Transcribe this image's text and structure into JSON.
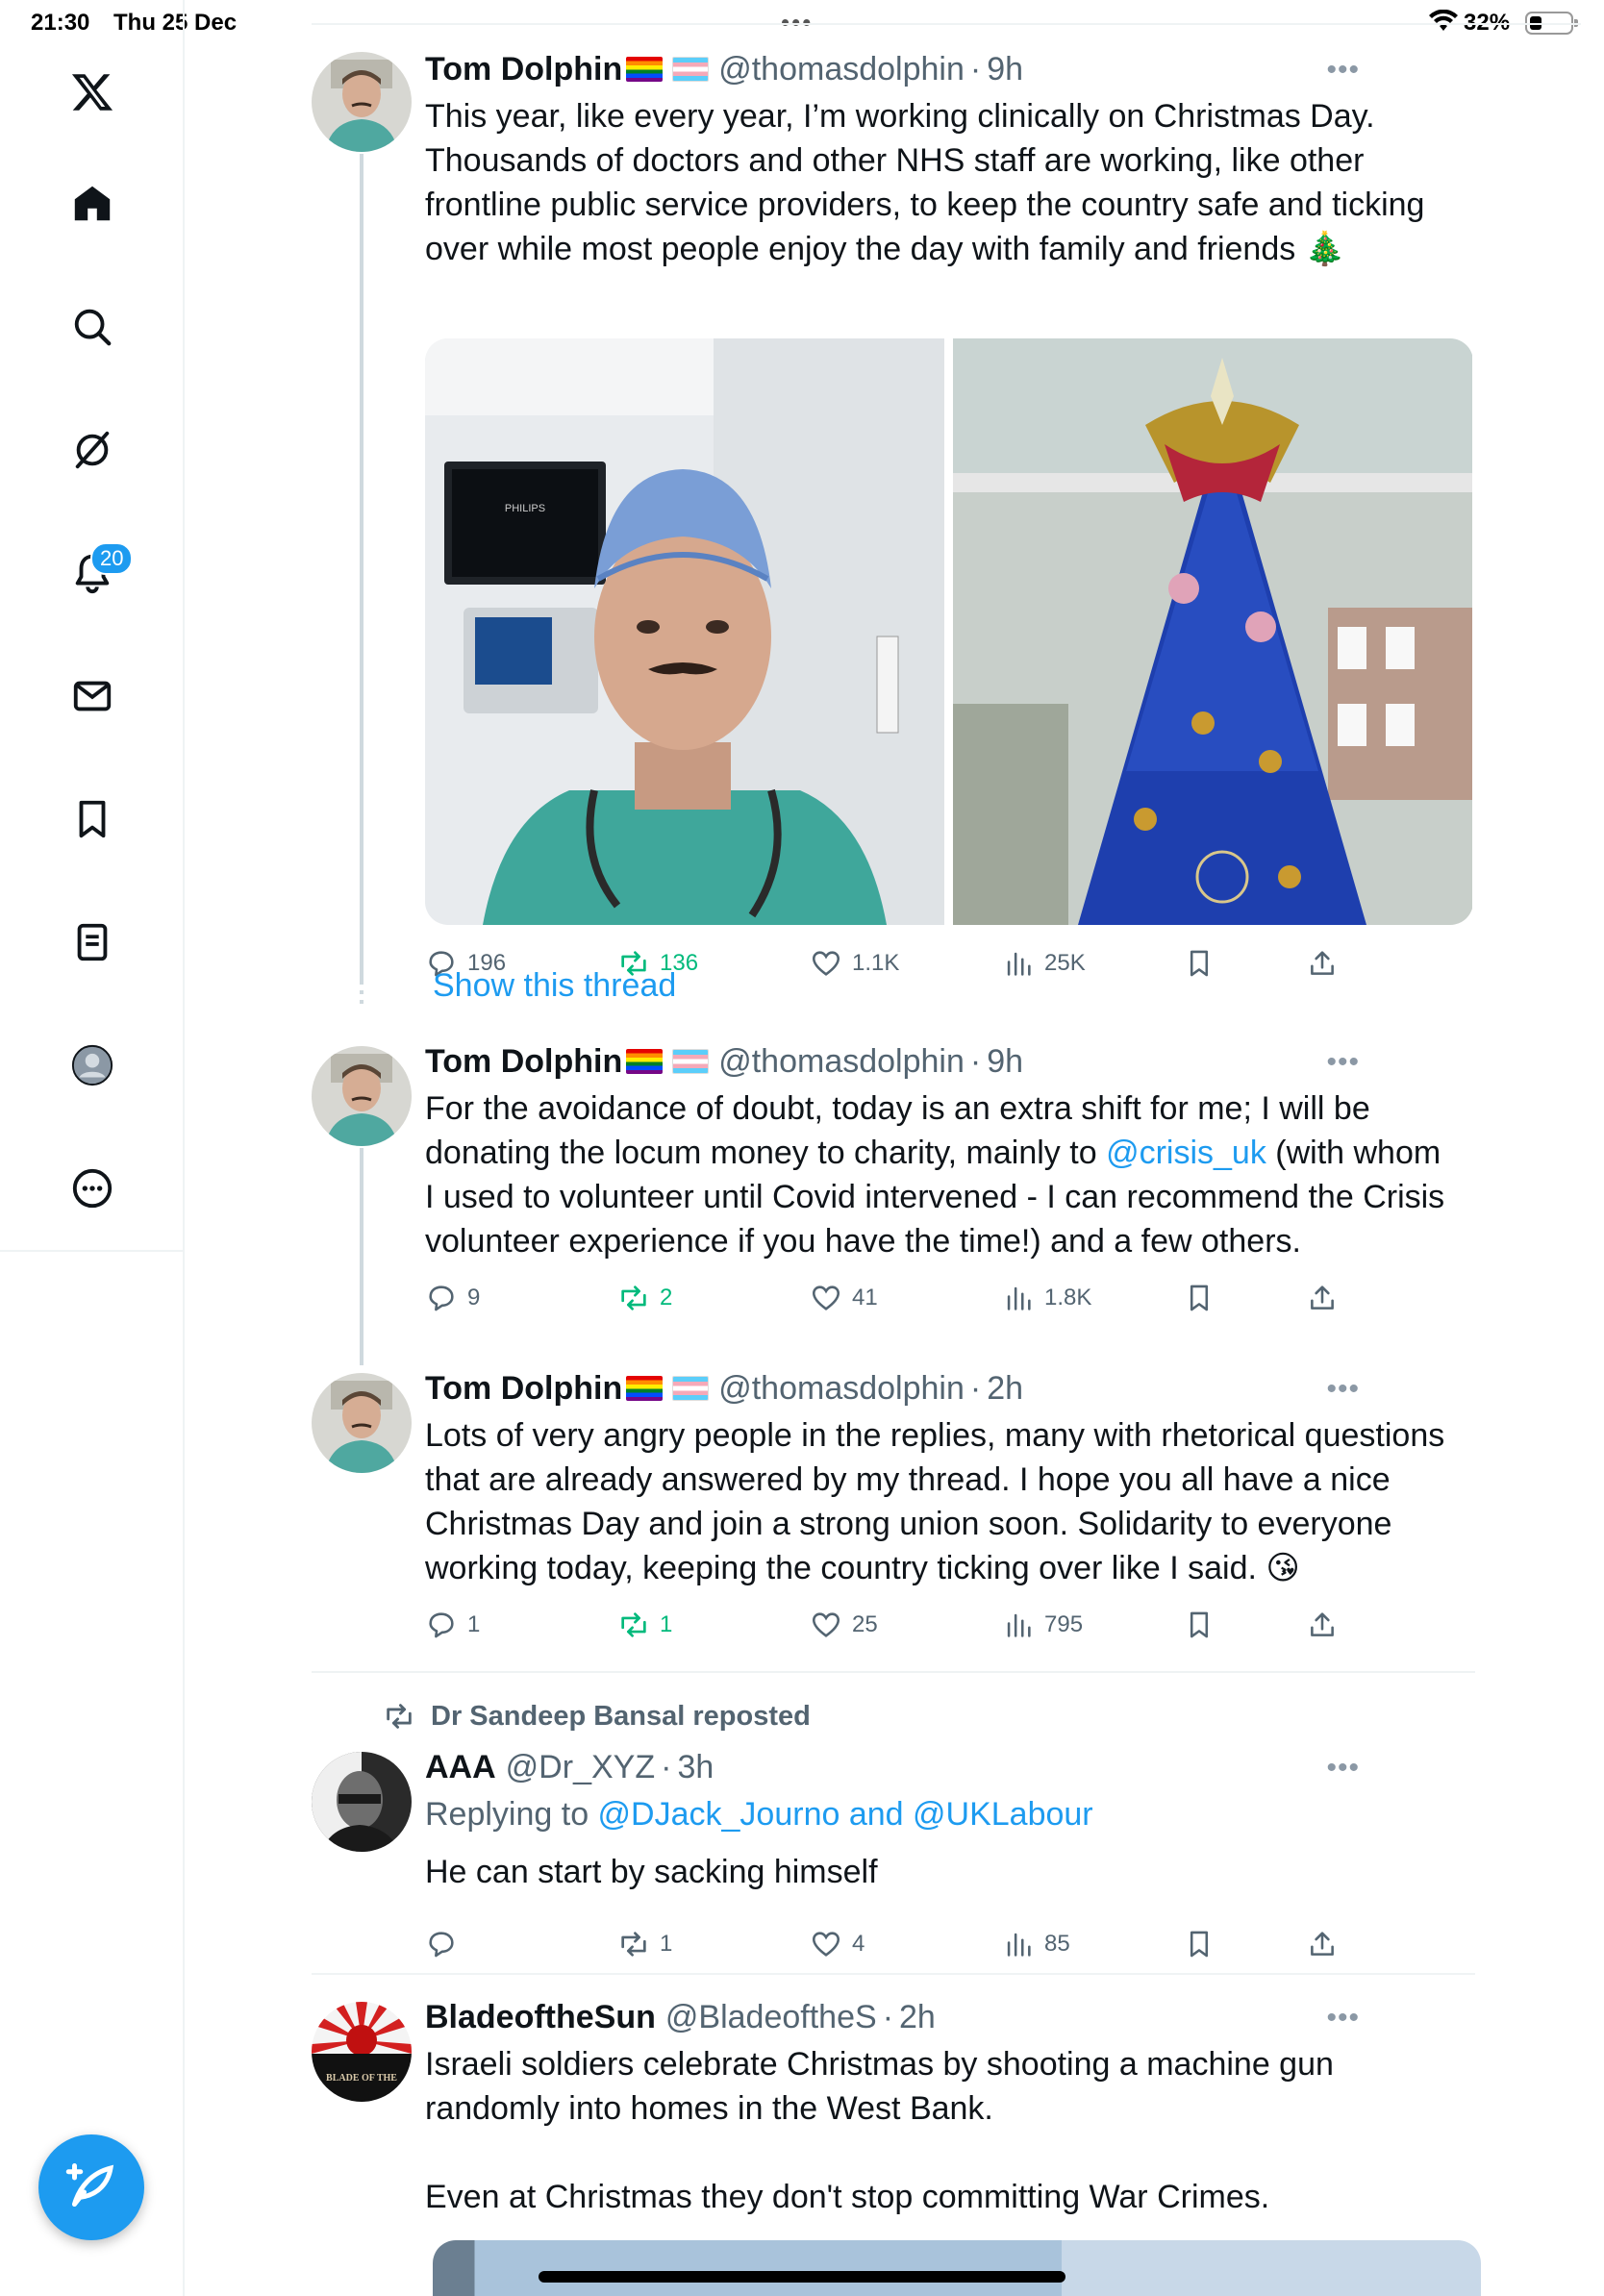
{
  "status_bar": {
    "time": "21:30",
    "date": "Thu 25 Dec",
    "battery": "32%",
    "multitask_dots": "•••"
  },
  "sidebar": {
    "items": [
      {
        "name": "x-logo-icon"
      },
      {
        "name": "home-icon"
      },
      {
        "name": "search-icon"
      },
      {
        "name": "grok-icon"
      },
      {
        "name": "notifications-icon",
        "badge": "20"
      },
      {
        "name": "messages-icon"
      },
      {
        "name": "bookmarks-icon"
      },
      {
        "name": "lists-icon"
      },
      {
        "name": "profile-icon"
      },
      {
        "name": "more-icon"
      }
    ],
    "compose_icon": "compose-feather-icon"
  },
  "tweets": [
    {
      "name": "Tom Dolphin",
      "handle": "@thomasdolphin",
      "age": "9h",
      "more": "•••",
      "lines": [
        "This year, like every year, I’m working clinically on Christmas Day.",
        "Thousands of doctors and other NHS staff are working, like other",
        "frontline public service providers, to keep the country safe and ticking",
        "over while most people enjoy the day with family and friends 🎄"
      ],
      "stats": {
        "replies": "196",
        "reposts": "136",
        "likes": "1.1K",
        "views": "25K"
      }
    },
    {
      "name": "Tom Dolphin",
      "handle": "@thomasdolphin",
      "age": "9h",
      "more": "•••",
      "line1": "For the avoidance of doubt, today is an extra shift for me; I will be",
      "line2_pre": "donating the locum money to charity, mainly to ",
      "line2_link": "@crisis_uk",
      "line2_post": " (with whom",
      "line3": "I used to volunteer until Covid intervened - I can recommend the Crisis",
      "line4": "volunteer experience if you have the time!) and a few others.",
      "stats": {
        "replies": "9",
        "reposts": "2",
        "likes": "41",
        "views": "1.8K"
      }
    },
    {
      "name": "Tom Dolphin",
      "handle": "@thomasdolphin",
      "age": "2h",
      "more": "•••",
      "lines": [
        "Lots of very angry people in the replies, many with rhetorical questions",
        "that are already answered by my thread. I hope you all have a nice",
        "Christmas Day and join a strong union soon. Solidarity to everyone",
        "working today, keeping the country ticking over like I said. 😘"
      ],
      "stats": {
        "replies": "1",
        "reposts": "1",
        "likes": "25",
        "views": "795"
      }
    },
    {
      "repost_by": "Dr Sandeep Bansal reposted",
      "name": "AAA",
      "handle": "@Dr_XYZ",
      "age": "3h",
      "more": "•••",
      "replying_prefix": "Replying to ",
      "replying_to": "@DJack_Journo and @UKLabour",
      "text": "He can start by sacking himself",
      "stats": {
        "replies": "",
        "reposts": "1",
        "likes": "4",
        "views": "85"
      }
    },
    {
      "name": "BladeoftheSun",
      "handle": "@BladeoftheS",
      "age": "2h",
      "more": "•••",
      "avatar_text": "BLADE OF THE",
      "lines": [
        "Israeli soldiers celebrate Christmas by shooting a machine gun",
        "randomly into homes in the West Bank.",
        "",
        "Even at Christmas they don't stop committing War Crimes."
      ]
    }
  ],
  "show_thread": "Show this thread",
  "colors": {
    "accent": "#1d9bf0",
    "repost_green": "#00ba7c",
    "muted": "#536471",
    "text": "#0f1419"
  }
}
